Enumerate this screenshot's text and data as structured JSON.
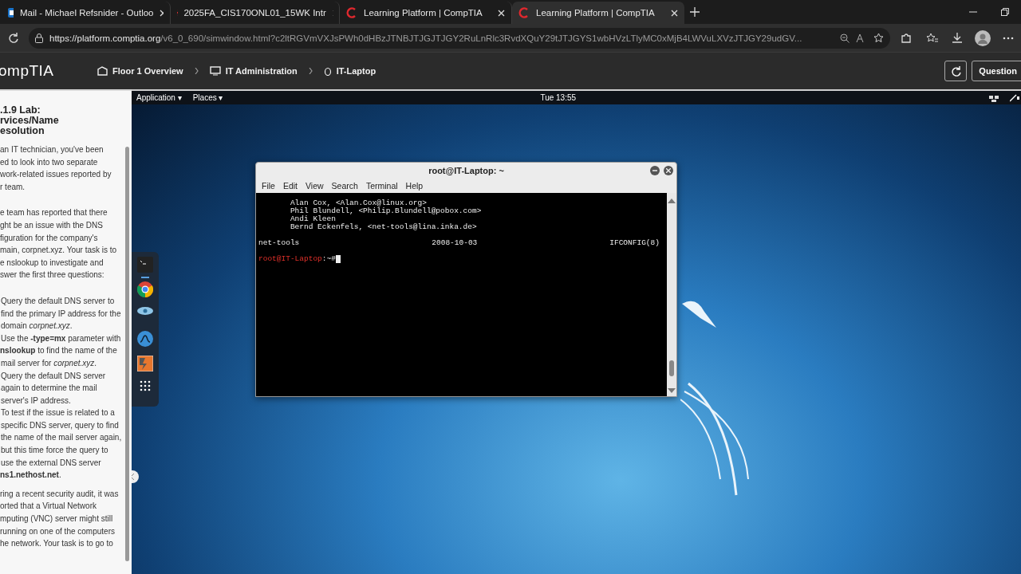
{
  "browser": {
    "tabs": [
      {
        "kind": "mail",
        "title": "Mail - Michael Refsnider - Outloo",
        "selected": false
      },
      {
        "kind": "course",
        "title": "2025FA_CIS170ONL01_15WK Intr",
        "selected": false
      },
      {
        "kind": "comptia",
        "title": "Learning Platform | CompTIA",
        "selected": false
      },
      {
        "kind": "comptia",
        "title": "Learning Platform | CompTIA",
        "selected": true
      }
    ],
    "url_host": "https://platform.comptia.org",
    "url_path": "/v6_0_690/simwindow.html?c2ltRGVmVXJsPWh0dHBzJTNBJTJGJTJGY2RuLnRlc3RvdXQuY29tJTJGYS1wbHVzLTlyMC0xMjB4LWVuLXVzJTJGY29udGV..."
  },
  "app_header": {
    "logo": "ompTIA",
    "breadcrumbs": [
      {
        "kind": "floor",
        "label": "Floor 1 Overview"
      },
      {
        "kind": "admin",
        "label": "IT Administration"
      },
      {
        "kind": "laptop",
        "label": "IT-Laptop"
      }
    ],
    "question_button": "Question"
  },
  "lab": {
    "title_lines": [
      ".1.9 Lab:",
      "rvices/Name",
      "esolution"
    ],
    "blocks": [
      {
        "kind": "paragraph",
        "lines": [
          "an IT technician, you've been",
          "ed to look into two separate",
          "work-related issues reported by",
          "r team."
        ]
      },
      {
        "kind": "paragraph",
        "lines": [
          "e team has reported that there",
          "ght be an issue with the DNS",
          "figuration for the company's",
          "main, corpnet.xyz. Your task is to",
          "e nslookup to investigate and",
          "swer the first three questions:"
        ]
      },
      {
        "kind": "list",
        "items": [
          {
            "lines": [
              "Query the default DNS server to",
              "find the primary IP address for the",
              "domain *corpnet.xyz*."
            ]
          },
          {
            "lines": [
              "Use the **-type=mx** parameter with",
              "**nslookup** to find the name of the",
              "mail server for *corpnet.xyz*."
            ]
          },
          {
            "lines": [
              "Query the default DNS server",
              "again to determine the mail",
              "server's IP address."
            ]
          },
          {
            "lines": [
              "To test if the issue is related to a",
              "specific DNS server, query to find",
              "the name of the mail server again,",
              "but this time force the query to",
              "use the external DNS server",
              "**ns1.nethost.net**."
            ]
          }
        ]
      },
      {
        "kind": "paragraph",
        "lines": [
          "ring a recent security audit, it was",
          "orted that a Virtual Network",
          "mputing (VNC) server might still",
          "running on one of the computers",
          "he network. Your task is to go to"
        ]
      }
    ]
  },
  "desktop": {
    "panel": {
      "menus": [
        "Application ▾",
        "Places ▾"
      ],
      "clock": "Tue 13:55"
    },
    "dock": [
      {
        "kind": "terminal",
        "active": true
      },
      {
        "kind": "chrome",
        "active": false
      },
      {
        "kind": "eye",
        "active": false
      },
      {
        "kind": "wave",
        "active": false
      },
      {
        "kind": "burp",
        "active": false
      },
      {
        "kind": "grid",
        "active": false
      }
    ],
    "terminal": {
      "title": "root@IT-Laptop: ~",
      "menu": [
        "File",
        "Edit",
        "View",
        "Search",
        "Terminal",
        "Help"
      ],
      "lines": [
        "       Alan Cox, <Alan.Cox@linux.org>",
        "       Phil Blundell, <Philip.Blundell@pobox.com>",
        "       Andi Kleen",
        "       Bernd Eckenfels, <net-tools@lina.inka.de>"
      ],
      "footer": [
        "net-tools",
        "2008-10-03",
        "IFCONFIG(8)"
      ],
      "prompt_user": "root@IT-Laptop",
      "prompt_suffix": ":~#"
    }
  }
}
